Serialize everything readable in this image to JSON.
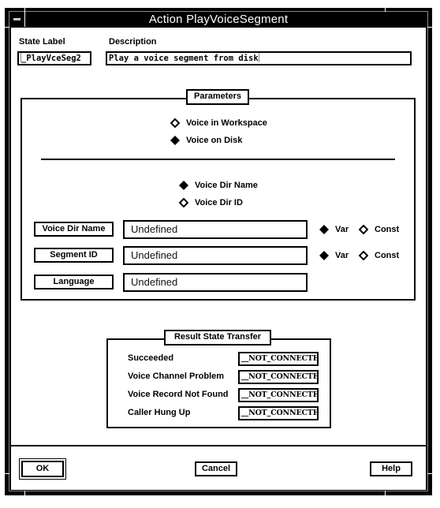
{
  "window": {
    "title": "Action PlayVoiceSegment"
  },
  "header": {
    "state_label_caption": "State Label",
    "state_label_value": "_PlayVceSeg2",
    "description_caption": "Description",
    "description_value": "Play a voice segment from disk"
  },
  "parameters": {
    "title": "Parameters",
    "source_options": [
      {
        "label": "Voice in Workspace",
        "selected": false
      },
      {
        "label": "Voice on Disk",
        "selected": true
      }
    ],
    "dir_options": [
      {
        "label": "Voice Dir Name",
        "selected": true
      },
      {
        "label": "Voice Dir ID",
        "selected": false
      }
    ],
    "rows": [
      {
        "button": "Voice Dir Name",
        "value": "Undefined",
        "mode": "Var",
        "var_label": "Var",
        "const_label": "Const",
        "has_mode": true
      },
      {
        "button": "Segment ID",
        "value": "Undefined",
        "mode": "Var",
        "var_label": "Var",
        "const_label": "Const",
        "has_mode": true
      },
      {
        "button": "Language",
        "value": "Undefined",
        "has_mode": false
      }
    ]
  },
  "result_transfer": {
    "title": "Result State Transfer",
    "rows": [
      {
        "label": "Succeeded",
        "value": "__NOT_CONNECTED"
      },
      {
        "label": "Voice Channel Problem",
        "value": "__NOT_CONNECTED"
      },
      {
        "label": "Voice Record Not Found",
        "value": "__NOT_CONNECTED"
      },
      {
        "label": "Caller Hung Up",
        "value": "__NOT_CONNECTED"
      }
    ]
  },
  "footer": {
    "ok_label": "OK",
    "cancel_label": "Cancel",
    "help_label": "Help"
  }
}
